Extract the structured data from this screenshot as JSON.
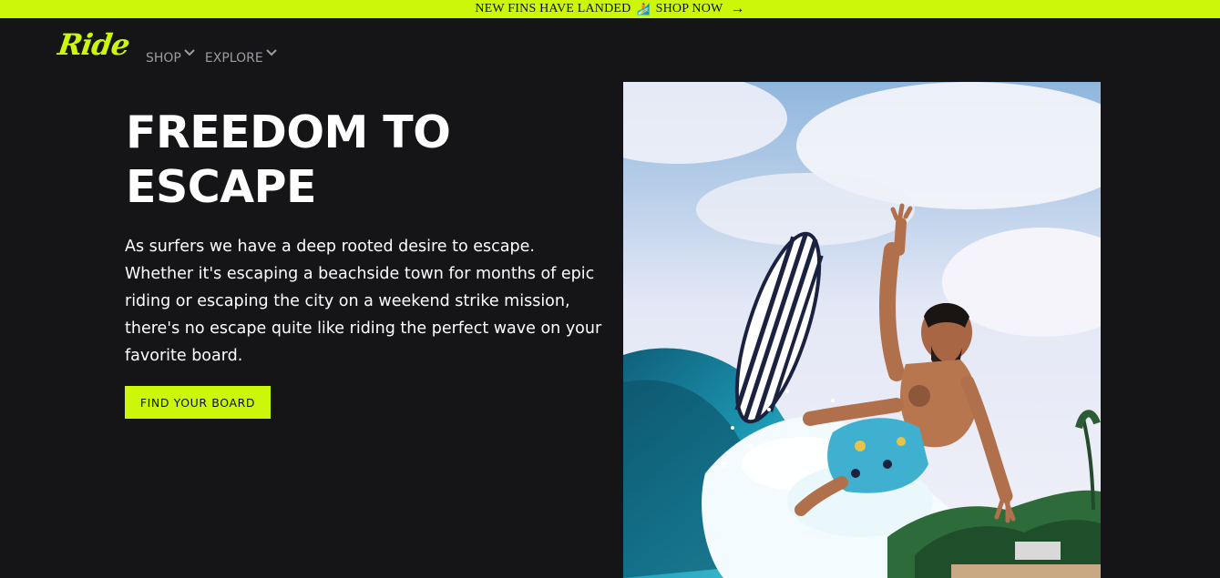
{
  "announcement": {
    "text": "NEW FINS HAVE LANDED",
    "icon": "wave-icon",
    "link_label": "SHOP NOW",
    "link_icon": "arrow-right-icon",
    "background": "#cdf70a"
  },
  "brand": {
    "logo_text": "Ride",
    "accent": "#cdf70a"
  },
  "nav": {
    "items": [
      {
        "label": "SHOP",
        "icon": "chevron-down-icon"
      },
      {
        "label": "EXPLORE",
        "icon": "chevron-down-icon"
      }
    ]
  },
  "hero": {
    "title_line1": "FREEDOM TO",
    "title_line2": "ESCAPE",
    "body_lines": [
      "As surfers we have a deep rooted desire to escape.",
      "Whether it's escaping a beachside town for months of epic",
      "riding or escaping the city on a weekend strike mission,",
      "there's no escape quite like riding the perfect wave on your",
      "favorite board."
    ],
    "cta_label": "FIND YOUR BOARD",
    "image_subject": "surfer-photo"
  },
  "colors": {
    "page_background": "#151517",
    "text": "#ffffff",
    "nav_text": "#9b9ba1"
  }
}
